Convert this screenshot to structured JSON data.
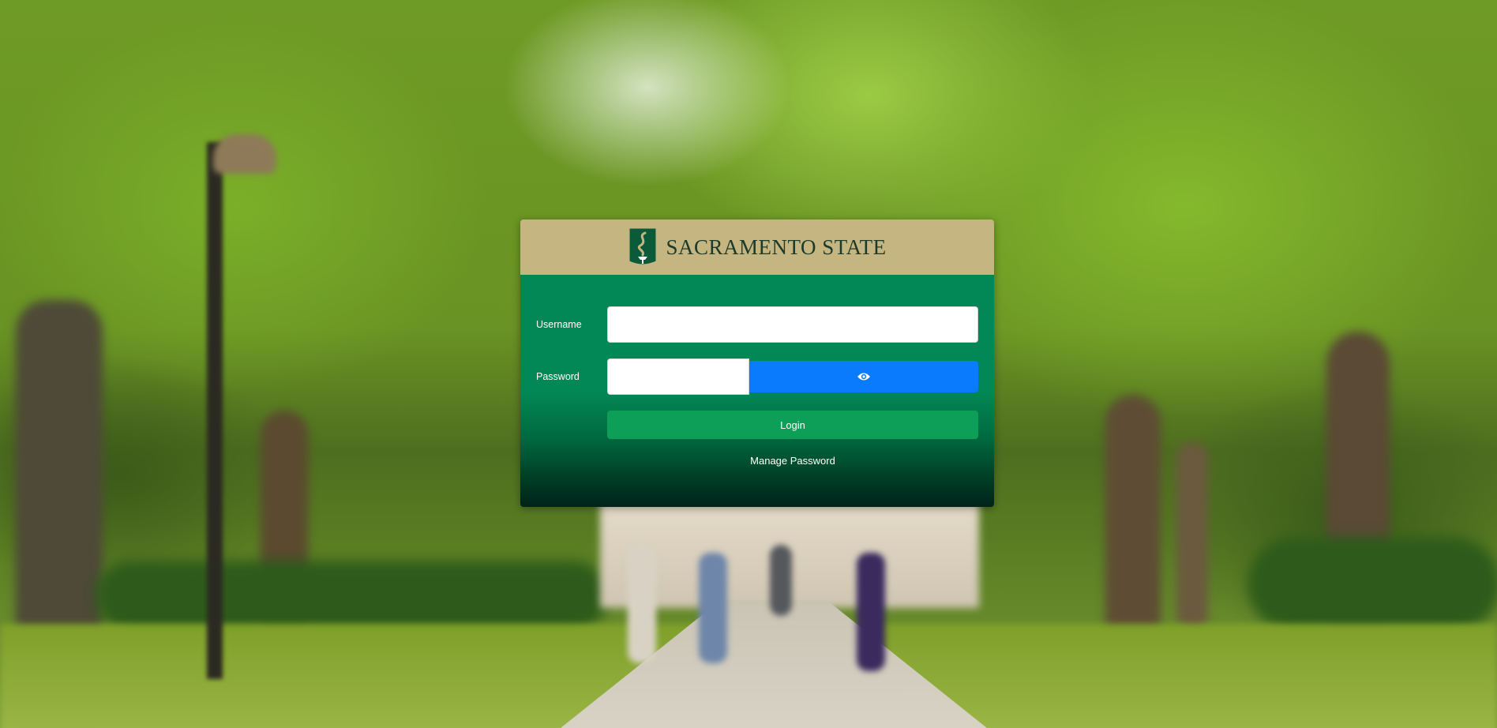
{
  "header": {
    "logo_text": "SACRAMENTO STATE",
    "logo_icon": "sac-state-seal-icon",
    "colors": {
      "gold": "#c4b581",
      "green": "#028856",
      "dark_green": "#1c3a2a"
    }
  },
  "form": {
    "username_label": "Username",
    "username_value": "",
    "password_label": "Password",
    "password_value": "",
    "show_password_icon": "eye-icon",
    "login_label": "Login",
    "manage_password_label": "Manage Password",
    "colors": {
      "login_button": "#0d9e57",
      "eye_button": "#0a7bfd"
    }
  }
}
